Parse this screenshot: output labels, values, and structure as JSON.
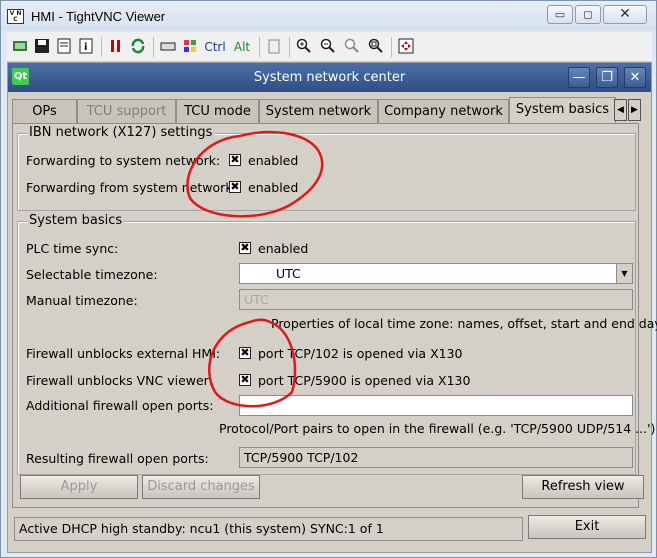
{
  "window": {
    "title": "HMI - TightVNC Viewer",
    "min": "▭",
    "max": "◻",
    "close": "✕"
  },
  "toolbar": {
    "ctrl": "Ctrl",
    "alt": "Alt"
  },
  "dialog": {
    "title": "System network center",
    "logo": "Qt",
    "min": "—",
    "max": "❐",
    "close": "✕"
  },
  "tabs": [
    {
      "label": "OPs",
      "disabled": false
    },
    {
      "label": "TCU support",
      "disabled": true
    },
    {
      "label": "TCU mode",
      "disabled": false
    },
    {
      "label": "System network",
      "disabled": false
    },
    {
      "label": "Company network",
      "disabled": false
    },
    {
      "label": "System basics",
      "disabled": false,
      "active": true
    }
  ],
  "ibn": {
    "title": "IBN network (X127) settings",
    "fwd_to_label": "Forwarding to system network:",
    "fwd_to_value": "enabled",
    "fwd_from_label": "Forwarding from system network:",
    "fwd_from_value": "enabled"
  },
  "basics": {
    "title": "System basics",
    "plc_label": "PLC time sync:",
    "plc_value": "enabled",
    "tz_label": "Selectable timezone:",
    "tz_value": "UTC",
    "manual_label": "Manual timezone:",
    "manual_value": "UTC",
    "tz_hint": "Properties of local time zone: names, offset, start and end day",
    "hmi_label": "Firewall unblocks external HMI:",
    "hmi_value": "port TCP/102 is opened via X130",
    "vnc_label": "Firewall unblocks VNC viewer:",
    "vnc_value": "port TCP/5900 is opened via X130",
    "addl_label": "Additional firewall open ports:",
    "addl_value": "",
    "addl_hint": "Protocol/Port pairs to open in the firewall (e.g. 'TCP/5900 UDP/514 ...')",
    "result_label": "Resulting firewall open ports:",
    "result_value": "TCP/5900 TCP/102"
  },
  "buttons": {
    "apply": "Apply",
    "discard": "Discard changes",
    "refresh": "Refresh view",
    "exit": "Exit"
  },
  "status": "Active DHCP high standby: ncu1 (this system) SYNC:1 of 1",
  "checkmark": "✖",
  "annotation_color": "#e01818"
}
